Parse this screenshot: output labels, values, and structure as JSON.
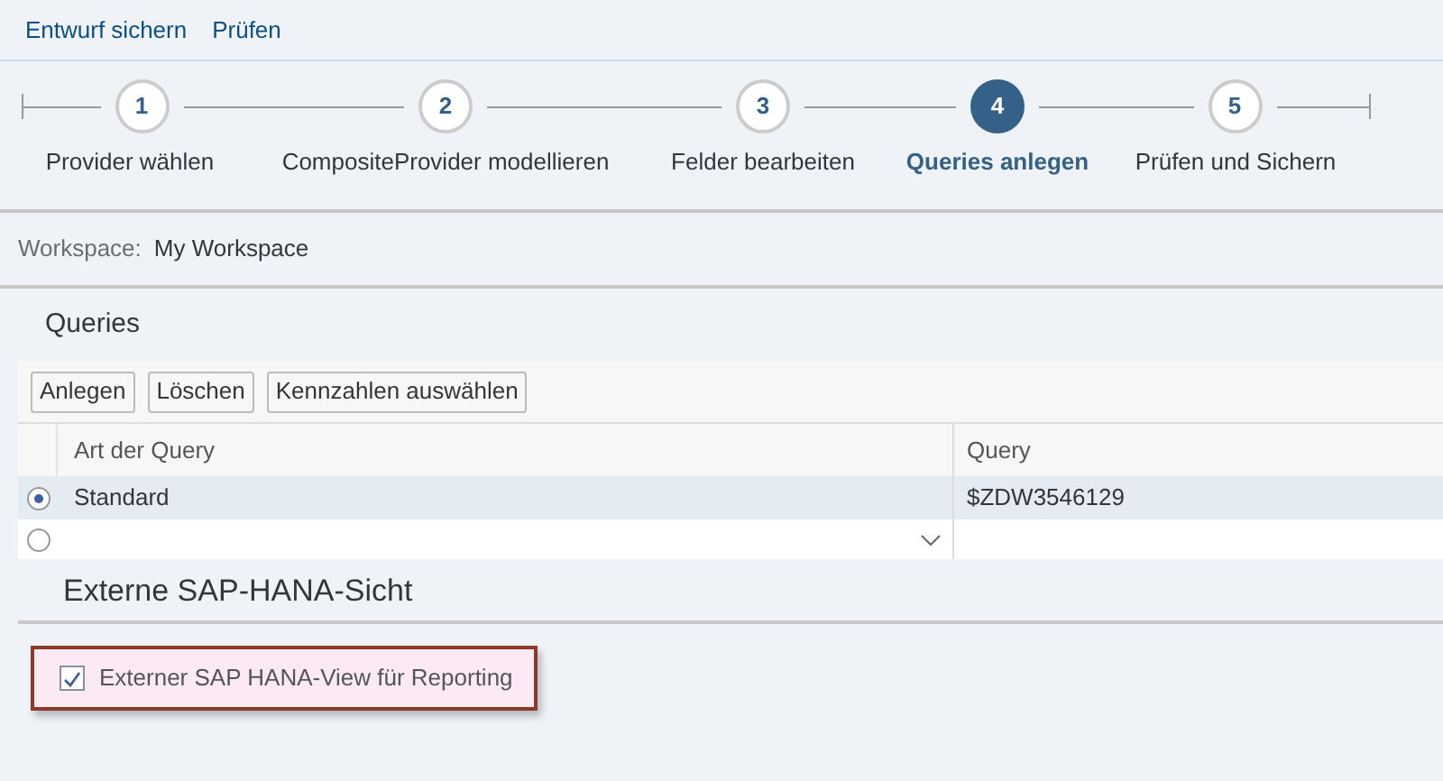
{
  "toolbar": [
    "Entwurf sichern",
    "Prüfen"
  ],
  "steps": [
    {
      "number": "1",
      "label": "Provider wählen",
      "selected": false
    },
    {
      "number": "2",
      "label": "CompositeProvider modellieren",
      "selected": false
    },
    {
      "number": "3",
      "label": "Felder bearbeiten",
      "selected": false
    },
    {
      "number": "4",
      "label": "Queries anlegen",
      "selected": true
    },
    {
      "number": "5",
      "label": "Prüfen und Sichern",
      "selected": false
    }
  ],
  "workspace": {
    "label": "Workspace:",
    "value": "My Workspace"
  },
  "queries": {
    "title": "Queries",
    "buttons": [
      "Anlegen",
      "Löschen",
      "Kennzahlen auswählen"
    ],
    "columns": [
      "Art der Query",
      "Query"
    ],
    "rows": [
      {
        "selected": true,
        "kind": "text",
        "type": "Standard",
        "query": "$ZDW3546129"
      },
      {
        "selected": false,
        "kind": "dropdown"
      }
    ]
  },
  "hana_view": {
    "title": "Externe SAP-HANA-Sicht",
    "checkbox": {
      "label": "Externer SAP HANA-View für Reporting",
      "checked": true
    }
  }
}
